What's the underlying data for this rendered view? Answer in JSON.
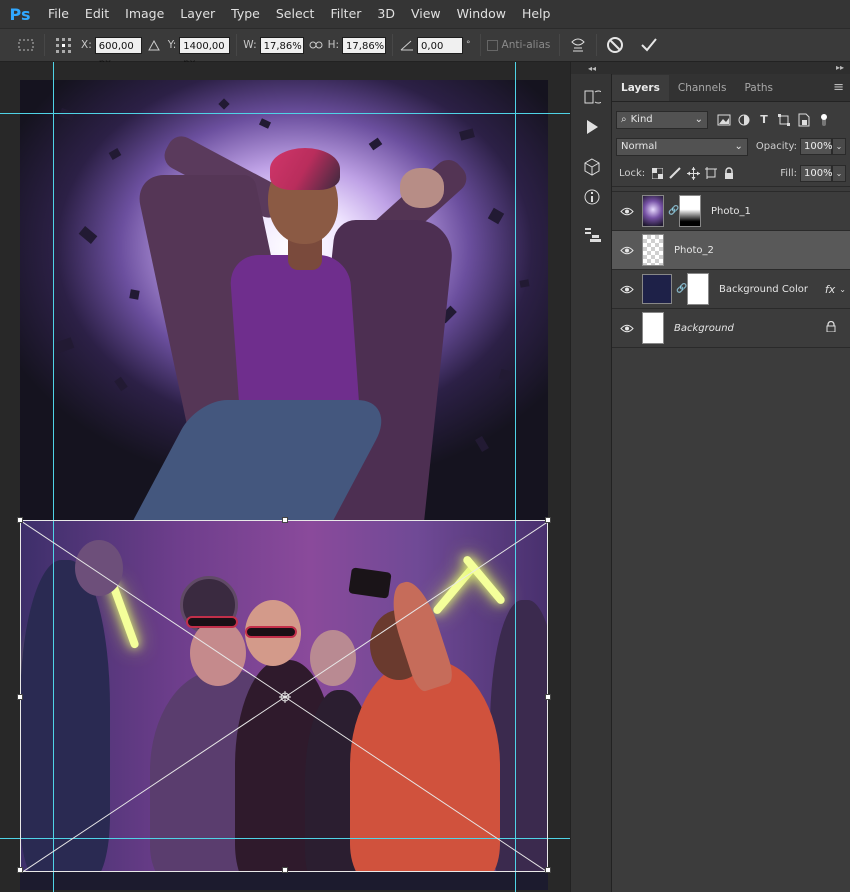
{
  "app": {
    "logo": "Ps"
  },
  "menu": [
    "File",
    "Edit",
    "Image",
    "Layer",
    "Type",
    "Select",
    "Filter",
    "3D",
    "View",
    "Window",
    "Help"
  ],
  "options": {
    "x_label": "X:",
    "x_value": "600,00 px",
    "y_label": "Y:",
    "y_value": "1400,00 px",
    "w_label": "W:",
    "w_value": "17,86%",
    "h_label": "H:",
    "h_value": "17,86%",
    "angle_value": "0,00",
    "angle_unit": "°",
    "antialias_label": "Anti-alias"
  },
  "layers_panel": {
    "tabs": [
      "Layers",
      "Channels",
      "Paths"
    ],
    "filter_kind": "Kind",
    "blend_mode": "Normal",
    "opacity_label": "Opacity:",
    "opacity_value": "100%",
    "lock_label": "Lock:",
    "fill_label": "Fill:",
    "fill_value": "100%",
    "layers": [
      {
        "name": "Photo_1",
        "selected": false
      },
      {
        "name": "Photo_2",
        "selected": true
      },
      {
        "name": "Background Color",
        "selected": false,
        "fx": "fx"
      },
      {
        "name": "Background",
        "selected": false,
        "locked": true
      }
    ]
  },
  "colors": {
    "guide": "#4fd3e6",
    "selection": "#595959",
    "ps_blue": "#31a8ff"
  }
}
